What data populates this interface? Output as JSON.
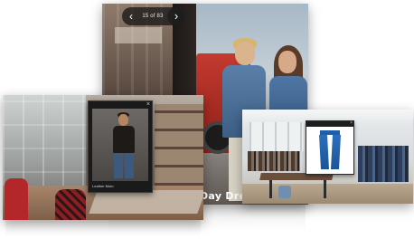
{
  "campaign_viewer": {
    "slide_counter": "15 of 83",
    "prev_arrow": "‹",
    "next_arrow": "›",
    "caption": "Day Dream"
  },
  "product_popup": {
    "close_glyph": "×",
    "label": "Leather Moto"
  },
  "jeans_tooltip": {
    "close_glyph": "×"
  },
  "icons": {
    "prev": "chevron-left-icon",
    "next": "chevron-right-icon",
    "close": "close-icon"
  },
  "colors": {
    "viewer_bg": "#2b2522",
    "popup_bg": "#1a1a1a",
    "tooltip_bg": "#ffffff",
    "caption_text": "#ffffff"
  }
}
